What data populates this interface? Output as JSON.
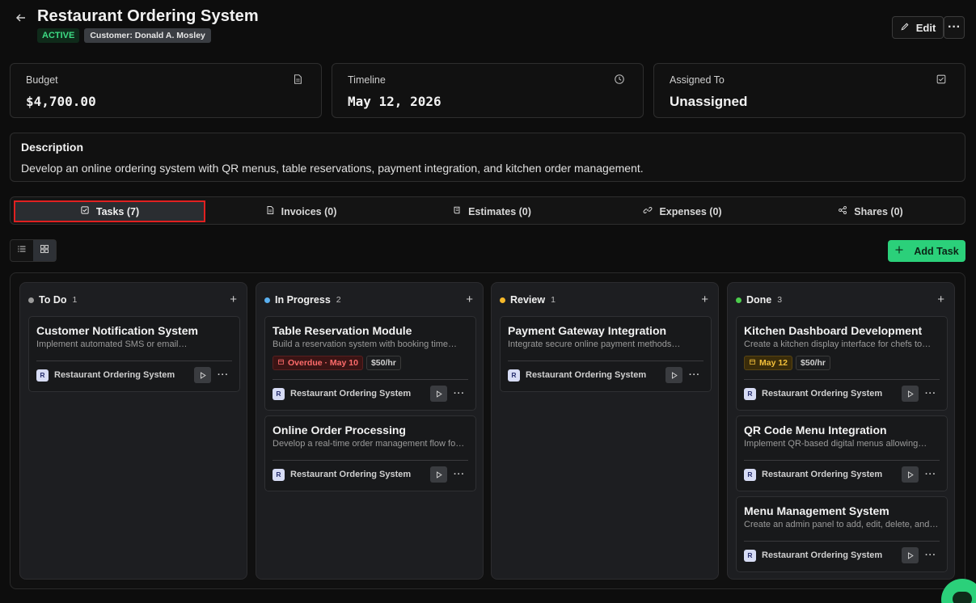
{
  "header": {
    "title": "Restaurant Ordering System",
    "status": "ACTIVE",
    "customer": "Customer: Donald A. Mosley",
    "edit_label": "Edit"
  },
  "stats": [
    {
      "label": "Budget",
      "value": "$4,700.00",
      "icon": "document-icon"
    },
    {
      "label": "Timeline",
      "value": "May 12, 2026",
      "icon": "clock-icon"
    },
    {
      "label": "Assigned To",
      "value": "Unassigned",
      "icon": "checkbox-icon"
    }
  ],
  "description": {
    "heading": "Description",
    "text": "Develop an online ordering system with QR menus, table reservations, payment integration, and kitchen order management."
  },
  "tabs": [
    {
      "label": "Tasks (7)",
      "icon": "checkbox-icon",
      "active": true
    },
    {
      "label": "Invoices (0)",
      "icon": "document-icon"
    },
    {
      "label": "Estimates (0)",
      "icon": "scroll-icon"
    },
    {
      "label": "Expenses (0)",
      "icon": "link-icon"
    },
    {
      "label": "Shares (0)",
      "icon": "share-icon"
    }
  ],
  "add_task_label": "Add Task",
  "columns": [
    {
      "name": "To Do",
      "count": "1",
      "color": "#9a9a9a",
      "cards": [
        {
          "title": "Customer Notification System",
          "desc": "Implement automated SMS or email…",
          "project": "Restaurant Ordering System",
          "project_initial": "R"
        }
      ]
    },
    {
      "name": "In Progress",
      "count": "2",
      "color": "#5ab0f0",
      "cards": [
        {
          "title": "Table Reservation Module",
          "desc": "Build a reservation system with booking time…",
          "overdue": "Overdue · May 10",
          "rate": "$50/hr",
          "project": "Restaurant Ordering System",
          "project_initial": "R"
        },
        {
          "title": "Online Order Processing",
          "desc": "Develop a real-time order management flow fo…",
          "project": "Restaurant Ordering System",
          "project_initial": "R"
        }
      ]
    },
    {
      "name": "Review",
      "count": "1",
      "color": "#f5b82a",
      "cards": [
        {
          "title": "Payment Gateway Integration",
          "desc": "Integrate secure online payment methods…",
          "project": "Restaurant Ordering System",
          "project_initial": "R"
        }
      ]
    },
    {
      "name": "Done",
      "count": "3",
      "color": "#4ccc4c",
      "cards": [
        {
          "title": "Kitchen Dashboard Development",
          "desc": "Create a kitchen display interface for chefs to…",
          "due": "May 12",
          "rate": "$50/hr",
          "project": "Restaurant Ordering System",
          "project_initial": "R"
        },
        {
          "title": "QR Code Menu Integration",
          "desc": "Implement QR-based digital menus allowing…",
          "project": "Restaurant Ordering System",
          "project_initial": "R"
        },
        {
          "title": "Menu Management System",
          "desc": "Create an admin panel to add, edit, delete, and…",
          "project": "Restaurant Ordering System",
          "project_initial": "R"
        }
      ]
    }
  ],
  "colors": {
    "accent": "#2bd07a",
    "active_tab_border": "#e02020"
  }
}
